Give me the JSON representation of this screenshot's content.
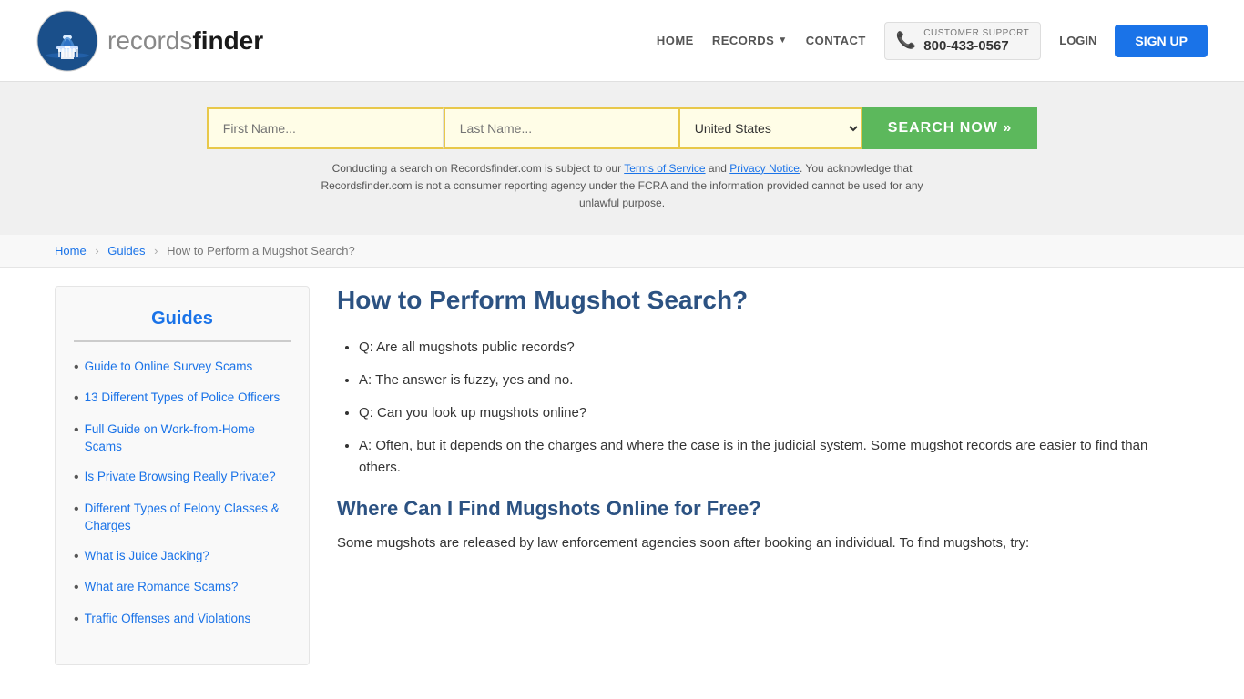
{
  "header": {
    "logo_text_light": "records",
    "logo_text_bold": "finder",
    "nav": {
      "home_label": "HOME",
      "records_label": "RECORDS",
      "contact_label": "CONTACT",
      "customer_support_label": "CUSTOMER SUPPORT",
      "phone": "800-433-0567",
      "login_label": "LOGIN",
      "signup_label": "SIGN UP"
    }
  },
  "search": {
    "first_name_placeholder": "First Name...",
    "last_name_placeholder": "Last Name...",
    "country_value": "United States",
    "search_button_label": "SEARCH NOW »",
    "disclaimer": "Conducting a search on Recordsfinder.com is subject to our Terms of Service and Privacy Notice. You acknowledge that Recordsfinder.com is not a consumer reporting agency under the FCRA and the information provided cannot be used for any unlawful purpose.",
    "terms_label": "Terms of Service",
    "privacy_label": "Privacy Notice"
  },
  "breadcrumb": {
    "home": "Home",
    "guides": "Guides",
    "current": "How to Perform a Mugshot Search?"
  },
  "sidebar": {
    "title": "Guides",
    "items": [
      {
        "label": "Guide to Online Survey Scams"
      },
      {
        "label": "13 Different Types of Police Officers"
      },
      {
        "label": "Full Guide on Work-from-Home Scams"
      },
      {
        "label": "Is Private Browsing Really Private?"
      },
      {
        "label": "Different Types of Felony Classes & Charges"
      },
      {
        "label": "What is Juice Jacking?"
      },
      {
        "label": "What are Romance Scams?"
      },
      {
        "label": "Traffic Offenses and Violations"
      }
    ]
  },
  "article": {
    "title": "How to Perform Mugshot Search?",
    "faq_items": [
      "Q: Are all mugshots public records?",
      "A: The answer is fuzzy, yes and no.",
      "Q: Can you look up mugshots online?",
      "A: Often, but it depends on the charges and where the case is in the judicial system. Some mugshot records are easier to find than others."
    ],
    "section2_title": "Where Can I Find Mugshots Online for Free?",
    "section2_text": "Some mugshots are released by law enforcement agencies soon after booking an individual. To find mugshots, try:"
  }
}
